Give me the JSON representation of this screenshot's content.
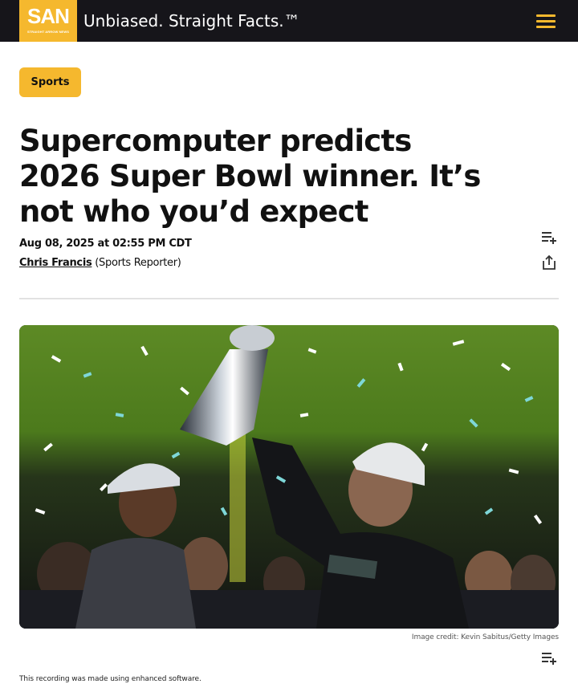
{
  "header": {
    "logo_text": "SAN",
    "logo_subtext": "STRAIGHT ARROW NEWS",
    "tagline": "Unbiased. Straight Facts.™",
    "menu_icon": "hamburger-menu-icon"
  },
  "article": {
    "category": "Sports",
    "headline": "Supercomputer predicts 2026 Super Bowl winner. It’s not who you’d expect",
    "date": "Aug 08, 2025 at 02:55 PM CDT",
    "author_name": "Chris Francis",
    "author_role": "(Sports Reporter)",
    "image_credit": "Image credit: Kevin Sabitus/Getty Images",
    "footnote": "This recording was made using enhanced software."
  },
  "icons": {
    "playlist_add": "playlist-add-icon",
    "share": "share-icon"
  },
  "colors": {
    "topbar": "#16151a",
    "accent": "#f5b82e",
    "text": "#111111",
    "divider": "#e2e2e2"
  }
}
